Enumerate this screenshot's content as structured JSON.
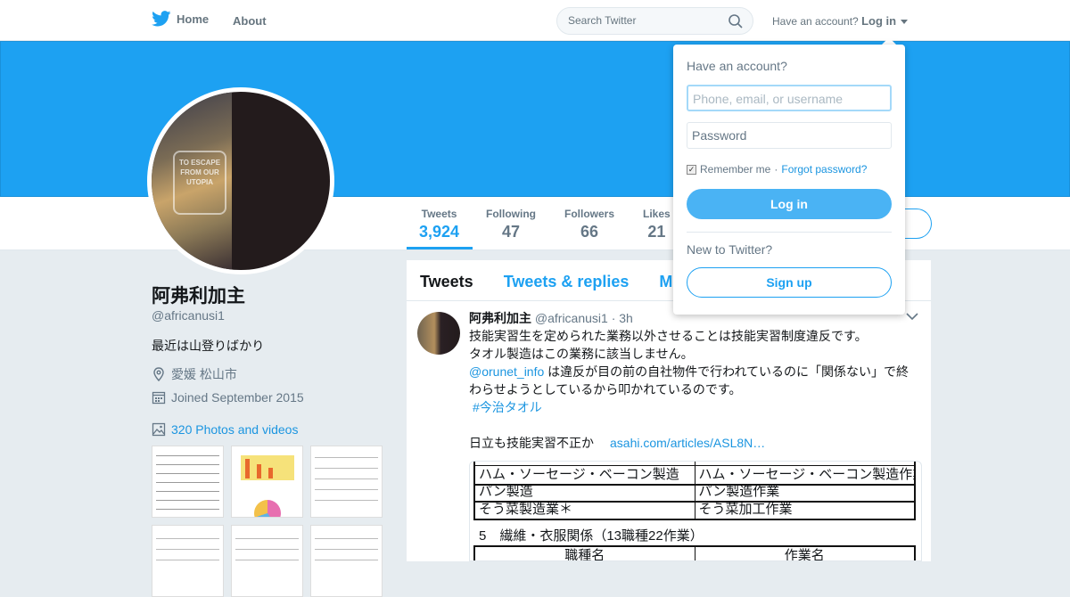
{
  "nav": {
    "home_label": "Home",
    "about_label": "About"
  },
  "search": {
    "placeholder": "Search Twitter"
  },
  "account": {
    "prompt": "Have an account?",
    "login_label": "Log in"
  },
  "profile": {
    "name": "阿弗利加主",
    "handle": "@africanusi1",
    "bio": "最近は山登りばかり",
    "location": "愛媛 松山市",
    "joined": "Joined September 2015",
    "photos_label": "320 Photos and videos",
    "avatar_sign_text": "TO ESCAPE FROM OUR UTOPIA"
  },
  "stats": [
    {
      "label": "Tweets",
      "value": "3,924"
    },
    {
      "label": "Following",
      "value": "47"
    },
    {
      "label": "Followers",
      "value": "66"
    },
    {
      "label": "Likes",
      "value": "21"
    }
  ],
  "tabs": [
    {
      "label": "Tweets"
    },
    {
      "label": "Tweets & replies"
    },
    {
      "label": "M"
    }
  ],
  "tweet": {
    "name": "阿弗利加主",
    "handle": "@africanusi1",
    "time": "· 3h",
    "line1": "技能実習生を定められた業務以外させることは技能実習制度違反です。",
    "line2": "タオル製造はこの業務に該当しません。",
    "mention": "@orunet_info",
    "line3": " は違反が目の前の自社物件で行われているのに「関係ない」で終わらせようとしているから叩かれているのです。",
    "hashtag": "#今治タオル",
    "line4": "日立も技能実習不正か",
    "link": "asahi.com/articles/ASL8N…",
    "image": {
      "rows": [
        [
          "ハム・ソーセージ・ベーコン製造",
          "ハム・ソーセージ・ベーコン製造作業"
        ],
        [
          "パン製造",
          "パン製造作業"
        ],
        [
          "そう菜製造業＊",
          "そう菜加工作業"
        ]
      ],
      "section": "5　繊維・衣服関係（13職種22作業）",
      "header": [
        "職種名",
        "作業名"
      ]
    }
  },
  "login_dropdown": {
    "title": "Have an account?",
    "username_placeholder": "Phone, email, or username",
    "password_placeholder": "Password",
    "remember_label": "Remember me",
    "separator": " · ",
    "forgot_label": "Forgot password?",
    "login_button": "Log in",
    "new_label": "New to Twitter?",
    "signup_button": "Sign up"
  },
  "colors": {
    "brand": "#1da1f2",
    "link": "#1b95e0",
    "muted": "#657786"
  }
}
